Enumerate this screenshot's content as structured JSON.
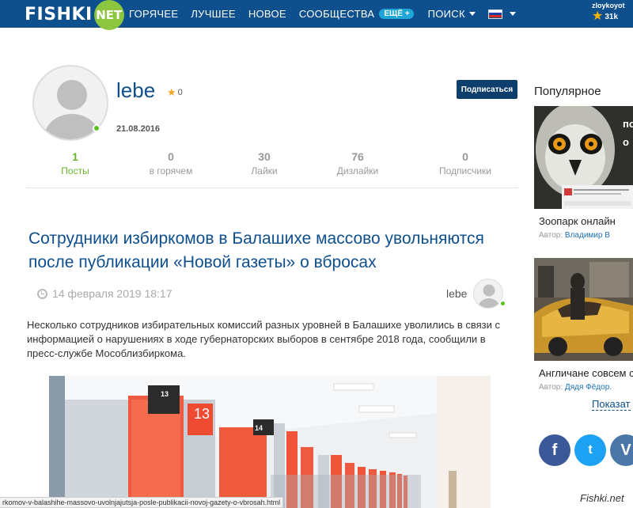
{
  "header": {
    "logo": "FISHKI",
    "logo_badge": "NET",
    "nav": [
      "ГОРЯЧЕЕ",
      "ЛУЧШЕЕ",
      "НОВОЕ",
      "СООБЩЕСТВА"
    ],
    "more_badge": "ЕЩЁ +",
    "search": "ПОИСК",
    "user": {
      "name": "zloykoyot",
      "rating": "31k"
    }
  },
  "profile": {
    "username": "lebe",
    "rating": "0",
    "registered": "21.08.2016",
    "subscribe_label": "Подписаться",
    "stats": [
      {
        "value": "1",
        "label": "Посты"
      },
      {
        "value": "0",
        "label": "в горячем"
      },
      {
        "value": "30",
        "label": "Лайки"
      },
      {
        "value": "76",
        "label": "Дизлайки"
      },
      {
        "value": "0",
        "label": "Подписчики"
      }
    ]
  },
  "post": {
    "title": "Сотрудники избиркомов в Балашихе массово увольняются после публикации «Новой газеты» о вбросах",
    "date": "14 февраля 2019 18:17",
    "author": "lebe",
    "text": "Несколько сотрудников избирательных комиссий разных уровней в Балашихе уволились в связи с информацией о нарушениях в ходе губернаторских выборов в сентябре 2018 года, сообщили в пресс-службе Мособлизбиркома.",
    "booth_numbers": [
      "13",
      "13",
      "14"
    ]
  },
  "status_url": "rkomov-v-balashihe-massovo-uvolnjajutsja-posle-publikacii-novoj-gazety-o-vbrosah.html",
  "sidebar": {
    "title": "Популярное",
    "cards": [
      {
        "title": "Зоопарк онлайн",
        "author_prefix": "Автор:",
        "author": "Владимир В"
      },
      {
        "title": "Англичане совсем с",
        "author_prefix": "Автор:",
        "author": "Дядя Фёдор."
      }
    ],
    "show_more": "Показат",
    "social": [
      "f",
      "t",
      "V"
    ],
    "social_icons": [
      "facebook-icon",
      "twitter-icon",
      "vk-icon"
    ]
  },
  "watermark": "Fishki.net",
  "colors": {
    "brand": "#0e4f8d",
    "accent_green": "#6ab42d",
    "subscribe": "#0e3e6b"
  }
}
